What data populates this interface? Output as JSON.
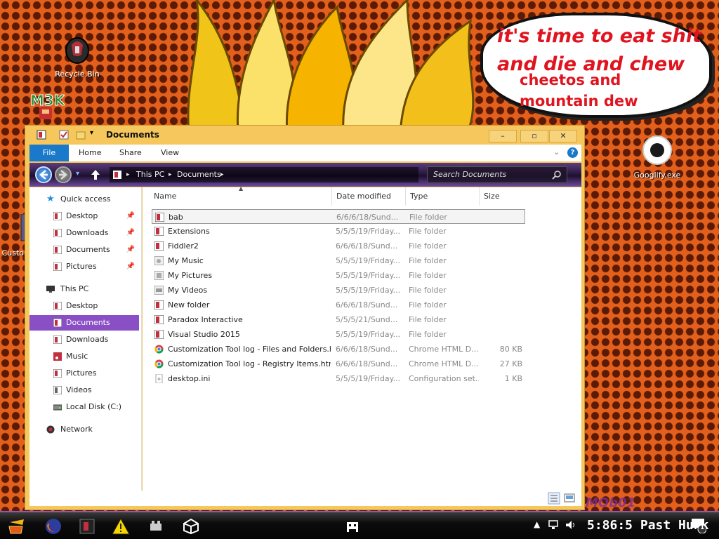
{
  "desktop": {
    "icons": [
      {
        "label": "Recycle Bin"
      },
      {
        "label": "Googlify.exe"
      },
      {
        "label": "Custo"
      }
    ],
    "speech_line1": "it's time to eat shit",
    "speech_line2": "and die and chew",
    "speech_line3": "cheetos and",
    "speech_line4": "mountain dew",
    "logo_text": "M3K",
    "watermark_text": "MOb01"
  },
  "window": {
    "title": "Documents",
    "controls": {
      "minimize": "–",
      "maximize": "▫",
      "close": "✕"
    },
    "ribbon_tabs": [
      "File",
      "Home",
      "Share",
      "View"
    ],
    "breadcrumb": [
      "This PC",
      "Documents"
    ],
    "search_placeholder": "Search Documents"
  },
  "sidebar": {
    "items": [
      {
        "label": "Quick access",
        "icon": "star-icon"
      },
      {
        "label": "Desktop",
        "icon": "folder-icon",
        "pinned": true
      },
      {
        "label": "Downloads",
        "icon": "folder-icon",
        "pinned": true
      },
      {
        "label": "Documents",
        "icon": "folder-icon",
        "pinned": true
      },
      {
        "label": "Pictures",
        "icon": "folder-icon",
        "pinned": true
      },
      {
        "label": "This PC",
        "icon": "computer-icon"
      },
      {
        "label": "Desktop",
        "icon": "folder-icon"
      },
      {
        "label": "Documents",
        "icon": "folder-icon",
        "selected": true
      },
      {
        "label": "Downloads",
        "icon": "folder-icon"
      },
      {
        "label": "Music",
        "icon": "music-icon"
      },
      {
        "label": "Pictures",
        "icon": "folder-icon"
      },
      {
        "label": "Videos",
        "icon": "folder-icon"
      },
      {
        "label": "Local Disk (C:)",
        "icon": "drive-icon"
      },
      {
        "label": "Network",
        "icon": "network-icon"
      }
    ]
  },
  "files": {
    "columns": [
      "Name",
      "Date modified",
      "Type",
      "Size"
    ],
    "rows": [
      {
        "name": "bab",
        "date": "6/6/6/18/Sund...",
        "type": "File folder",
        "size": "",
        "icon": "folder-icon"
      },
      {
        "name": "Extensions",
        "date": "5/5/5/19/Friday...",
        "type": "File folder",
        "size": "",
        "icon": "folder-icon"
      },
      {
        "name": "Fiddler2",
        "date": "6/6/6/18/Sund...",
        "type": "File folder",
        "size": "",
        "icon": "folder-icon"
      },
      {
        "name": "My Music",
        "date": "5/5/5/19/Friday...",
        "type": "File folder",
        "size": "",
        "icon": "music-folder-icon"
      },
      {
        "name": "My Pictures",
        "date": "5/5/5/19/Friday...",
        "type": "File folder",
        "size": "",
        "icon": "pictures-folder-icon"
      },
      {
        "name": "My Videos",
        "date": "5/5/5/19/Friday...",
        "type": "File folder",
        "size": "",
        "icon": "videos-folder-icon"
      },
      {
        "name": "New folder",
        "date": "6/6/6/18/Sund...",
        "type": "File folder",
        "size": "",
        "icon": "folder-icon"
      },
      {
        "name": "Paradox Interactive",
        "date": "5/5/5/21/Sund...",
        "type": "File folder",
        "size": "",
        "icon": "folder-icon"
      },
      {
        "name": "Visual Studio 2015",
        "date": "5/5/5/19/Friday...",
        "type": "File folder",
        "size": "",
        "icon": "folder-icon"
      },
      {
        "name": "Customization Tool log - Files and Folders.html",
        "date": "6/6/6/18/Sund...",
        "type": "Chrome HTML D...",
        "size": "80 KB",
        "icon": "chrome-icon"
      },
      {
        "name": "Customization Tool log - Registry Items.html",
        "date": "6/6/6/18/Sund...",
        "type": "Chrome HTML D...",
        "size": "27 KB",
        "icon": "chrome-icon"
      },
      {
        "name": "desktop.ini",
        "date": "5/5/5/19/Friday...",
        "type": "Configuration set...",
        "size": "1 KB",
        "icon": "settings-file-icon"
      }
    ]
  },
  "taskbar": {
    "clock": "5:86:5 Past Hunk",
    "notification_count": "1"
  },
  "colors": {
    "accent": "#8a4fc4",
    "file_tab": "#1979ca",
    "window_frame": "#f5c75d",
    "speech_text": "#e0141f"
  }
}
